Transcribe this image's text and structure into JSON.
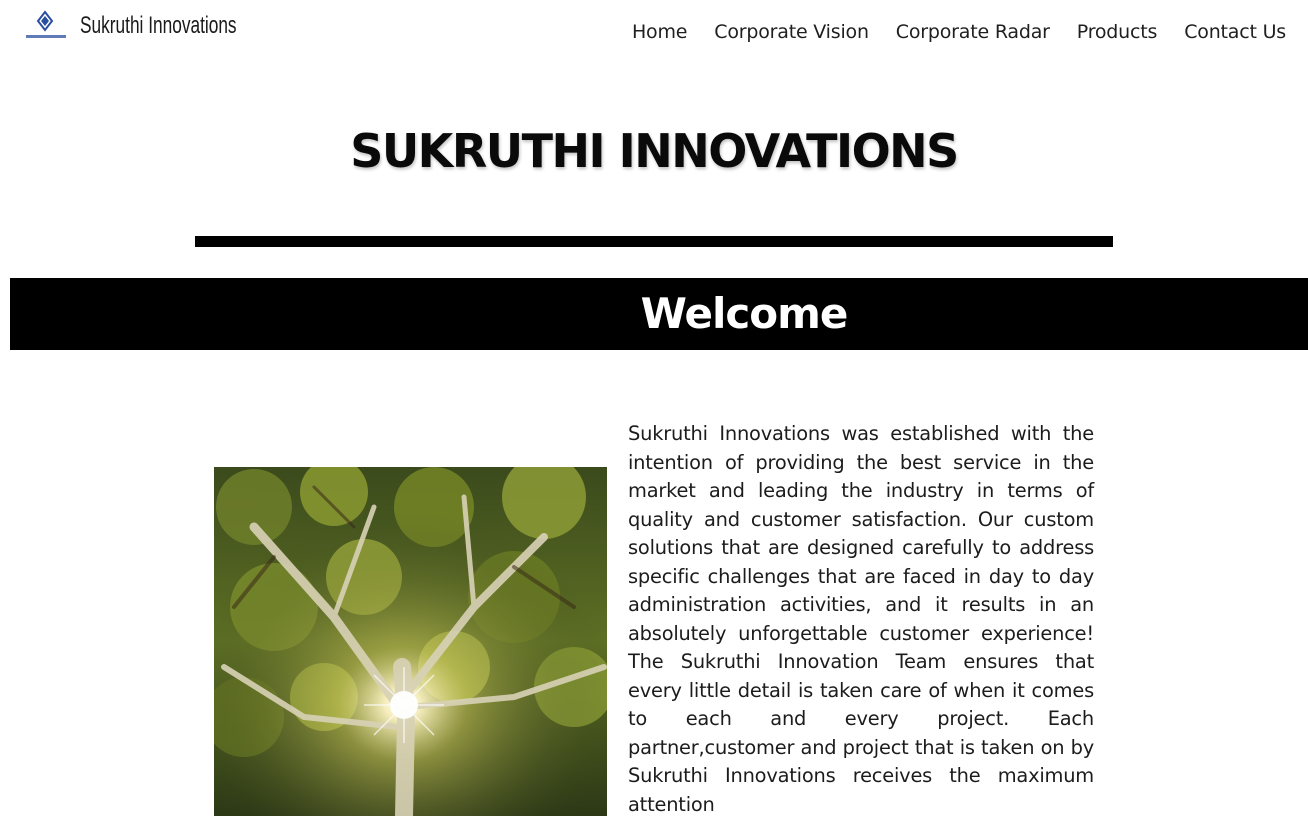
{
  "brand": {
    "name": "Sukruthi Innovations",
    "logo_icon": "sukruthi-diamond-logo",
    "accent_color": "#2a4fa0"
  },
  "nav": {
    "items": [
      {
        "label": "Home"
      },
      {
        "label": "Corporate Vision"
      },
      {
        "label": "Corporate Radar"
      },
      {
        "label": "Products"
      },
      {
        "label": "Contact Us"
      }
    ]
  },
  "hero": {
    "title": "SUKRUTHI INNOVATIONS"
  },
  "welcome": {
    "heading": "Welcome"
  },
  "intro": {
    "image_icon": "tree-canopy-photo",
    "paragraph": "Sukruthi Innovations was established with the intention of providing the best service in the market and leading the industry in terms of quality and customer satisfaction. Our custom solutions that are designed carefully to address specific challenges that are faced in day to day administration activities, and it results in an absolutely unforgettable customer experience! The Sukruthi Innovation Team ensures that every little detail is taken care of when it comes to each and every project. Each partner,customer and project that is taken on by Sukruthi Innovations receives the maximum attention"
  }
}
